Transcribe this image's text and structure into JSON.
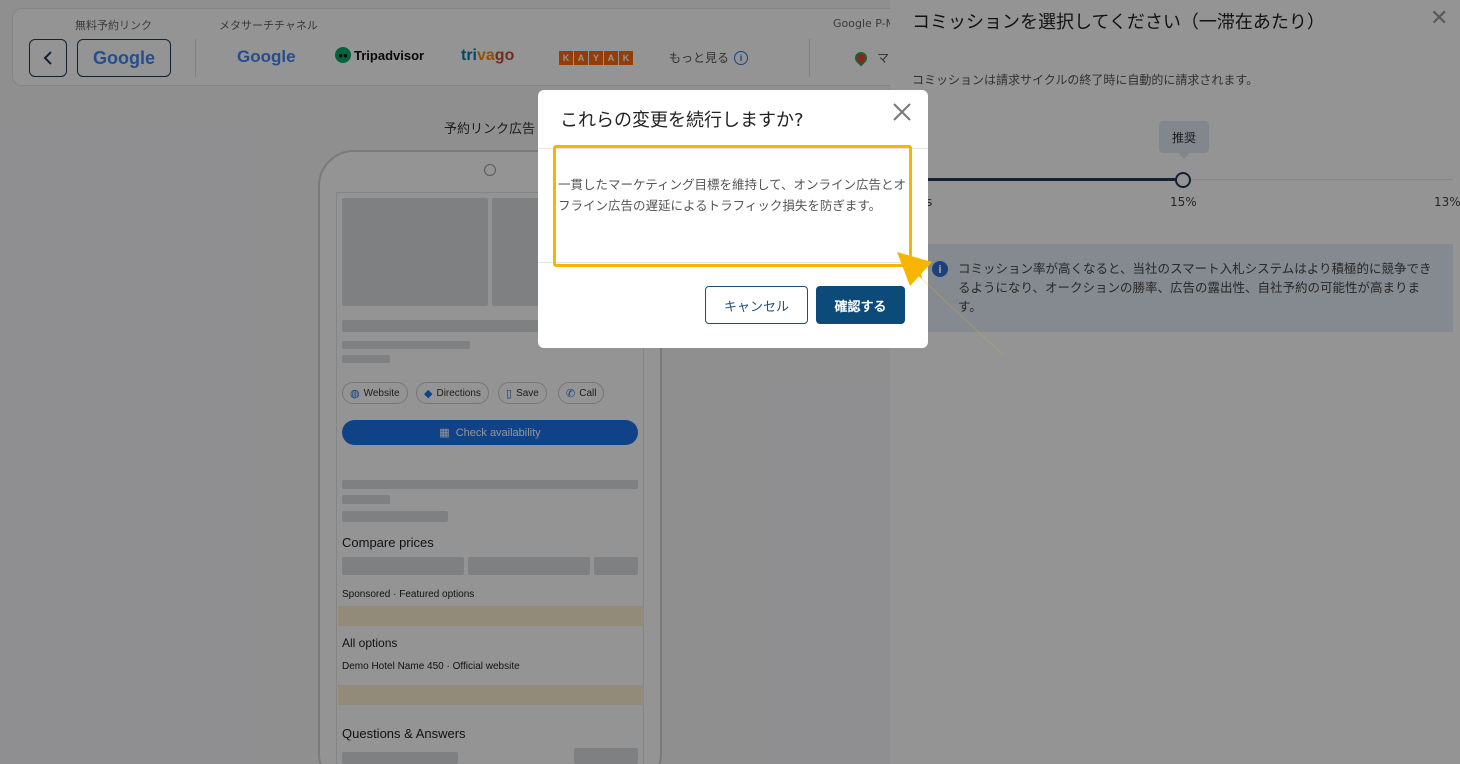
{
  "header": {
    "free_booking_label": "無料予約リンク",
    "meta_channel_label": "メタサーチチャネル",
    "google_pm_label": "Google P-M",
    "google_button": "Google",
    "channels": {
      "google": "Google",
      "tripadvisor": "Tripadvisor",
      "trivago": "trivago",
      "kayak": [
        "K",
        "A",
        "Y",
        "A",
        "K"
      ],
      "more": "もっと見る"
    },
    "maps_partial": "マ"
  },
  "preview": {
    "title": "予約リンク広告",
    "chips": [
      "Website",
      "Directions",
      "Save",
      "Call"
    ],
    "check_availability": "Check availability",
    "compare_prices": "Compare prices",
    "sponsored": "Sponsored · Featured options",
    "all_options": "All options",
    "hotel_row": "Demo Hotel Name 450 · Official website",
    "qa": "Questions & Answers"
  },
  "panel": {
    "title": "コミッションを選択してください（一滞在あたり）",
    "subtitle": "コミッションは請求サイクルの終了時に自動的に請求されます。",
    "tooltip": "推奨",
    "slider_min": "s",
    "slider_value": "15%",
    "slider_max": "13%",
    "slider_fraction": 0.45,
    "info": "コミッション率が高くなると、当社のスマート入札システムはより積極的に競争できるようになり、オークションの勝率、広告の露出性、自社予約の可能性が高まります。"
  },
  "modal": {
    "title": "これらの変更を続行しますか?",
    "body": "一貫したマーケティング目標を維持して、オンライン広告とオフライン広告の遅延によるトラフィック損失を防ぎます。",
    "cancel": "キャンセル",
    "confirm": "確認する"
  },
  "colors": {
    "highlight": "#f7b500",
    "primary": "#0c4a7a"
  }
}
